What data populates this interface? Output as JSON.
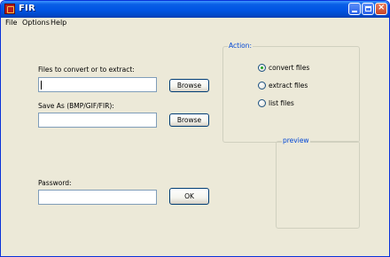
{
  "window": {
    "title": "FIR",
    "icon": "app-icon"
  },
  "menu": [
    "File",
    "Options",
    "Help"
  ],
  "files": {
    "label": "Files to convert or to extract:",
    "value": "",
    "browse_label": "Browse"
  },
  "saveas": {
    "label": "Save As (BMP/GIF/FIR):",
    "value": "",
    "browse_label": "Browse"
  },
  "password": {
    "label": "Password:",
    "value": "",
    "ok_label": "OK"
  },
  "action": {
    "title": "Action:",
    "options": [
      {
        "label": "convert files",
        "selected": true
      },
      {
        "label": "extract files",
        "selected": false
      },
      {
        "label": "list files",
        "selected": false
      }
    ]
  },
  "preview": {
    "title": "preview"
  },
  "colors": {
    "title_bar": "#0054e3",
    "group_label": "#0046d5",
    "radio_selected": "#21a121"
  }
}
